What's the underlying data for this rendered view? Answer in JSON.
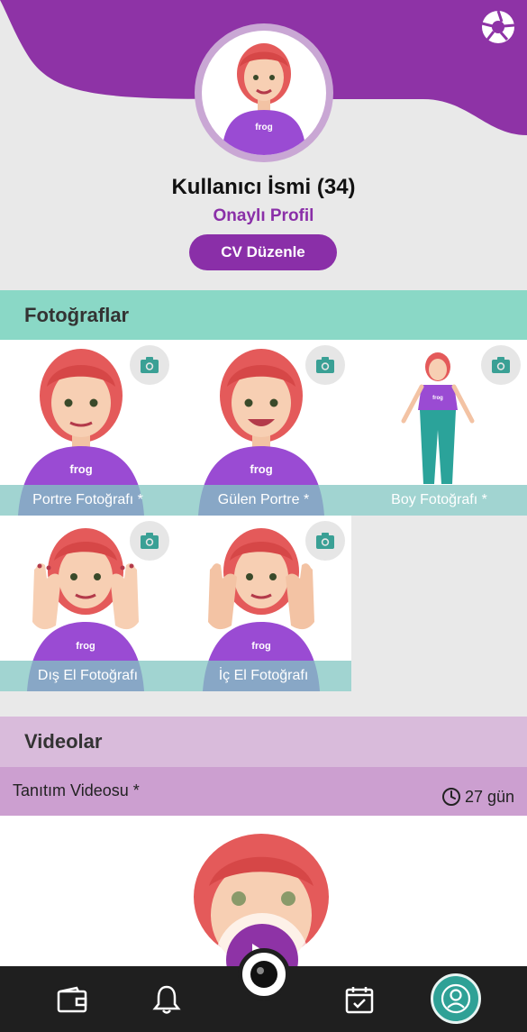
{
  "header": {
    "user_name": "Kullanıcı İsmi (34)",
    "verified_label": "Onaylı Profil",
    "cv_button_label": "CV Düzenle",
    "avatar_shirt_text": "frog"
  },
  "photos": {
    "title": "Fotoğraflar",
    "items": [
      {
        "label": "Portre Fotoğrafı *",
        "icon": "camera-icon"
      },
      {
        "label": "Gülen Portre *",
        "icon": "camera-icon"
      },
      {
        "label": "Boy Fotoğrafı *",
        "icon": "camera-icon"
      },
      {
        "label": "Dış El Fotoğrafı",
        "icon": "camera-icon"
      },
      {
        "label": "İç El Fotoğrafı",
        "icon": "camera-icon"
      }
    ]
  },
  "videos": {
    "title": "Videolar",
    "items": [
      {
        "title": "Tanıtım Videosu *",
        "remaining": "27 gün"
      }
    ]
  },
  "bottom_nav": {
    "items": [
      "wallet-icon",
      "bell-icon",
      "record-icon",
      "calendar-check-icon",
      "profile-icon"
    ]
  },
  "colors": {
    "brand_purple": "#8a2fa8",
    "teal": "#8ad8c6",
    "nav_bg": "#1f1f1f",
    "active_teal": "#2fa196"
  }
}
